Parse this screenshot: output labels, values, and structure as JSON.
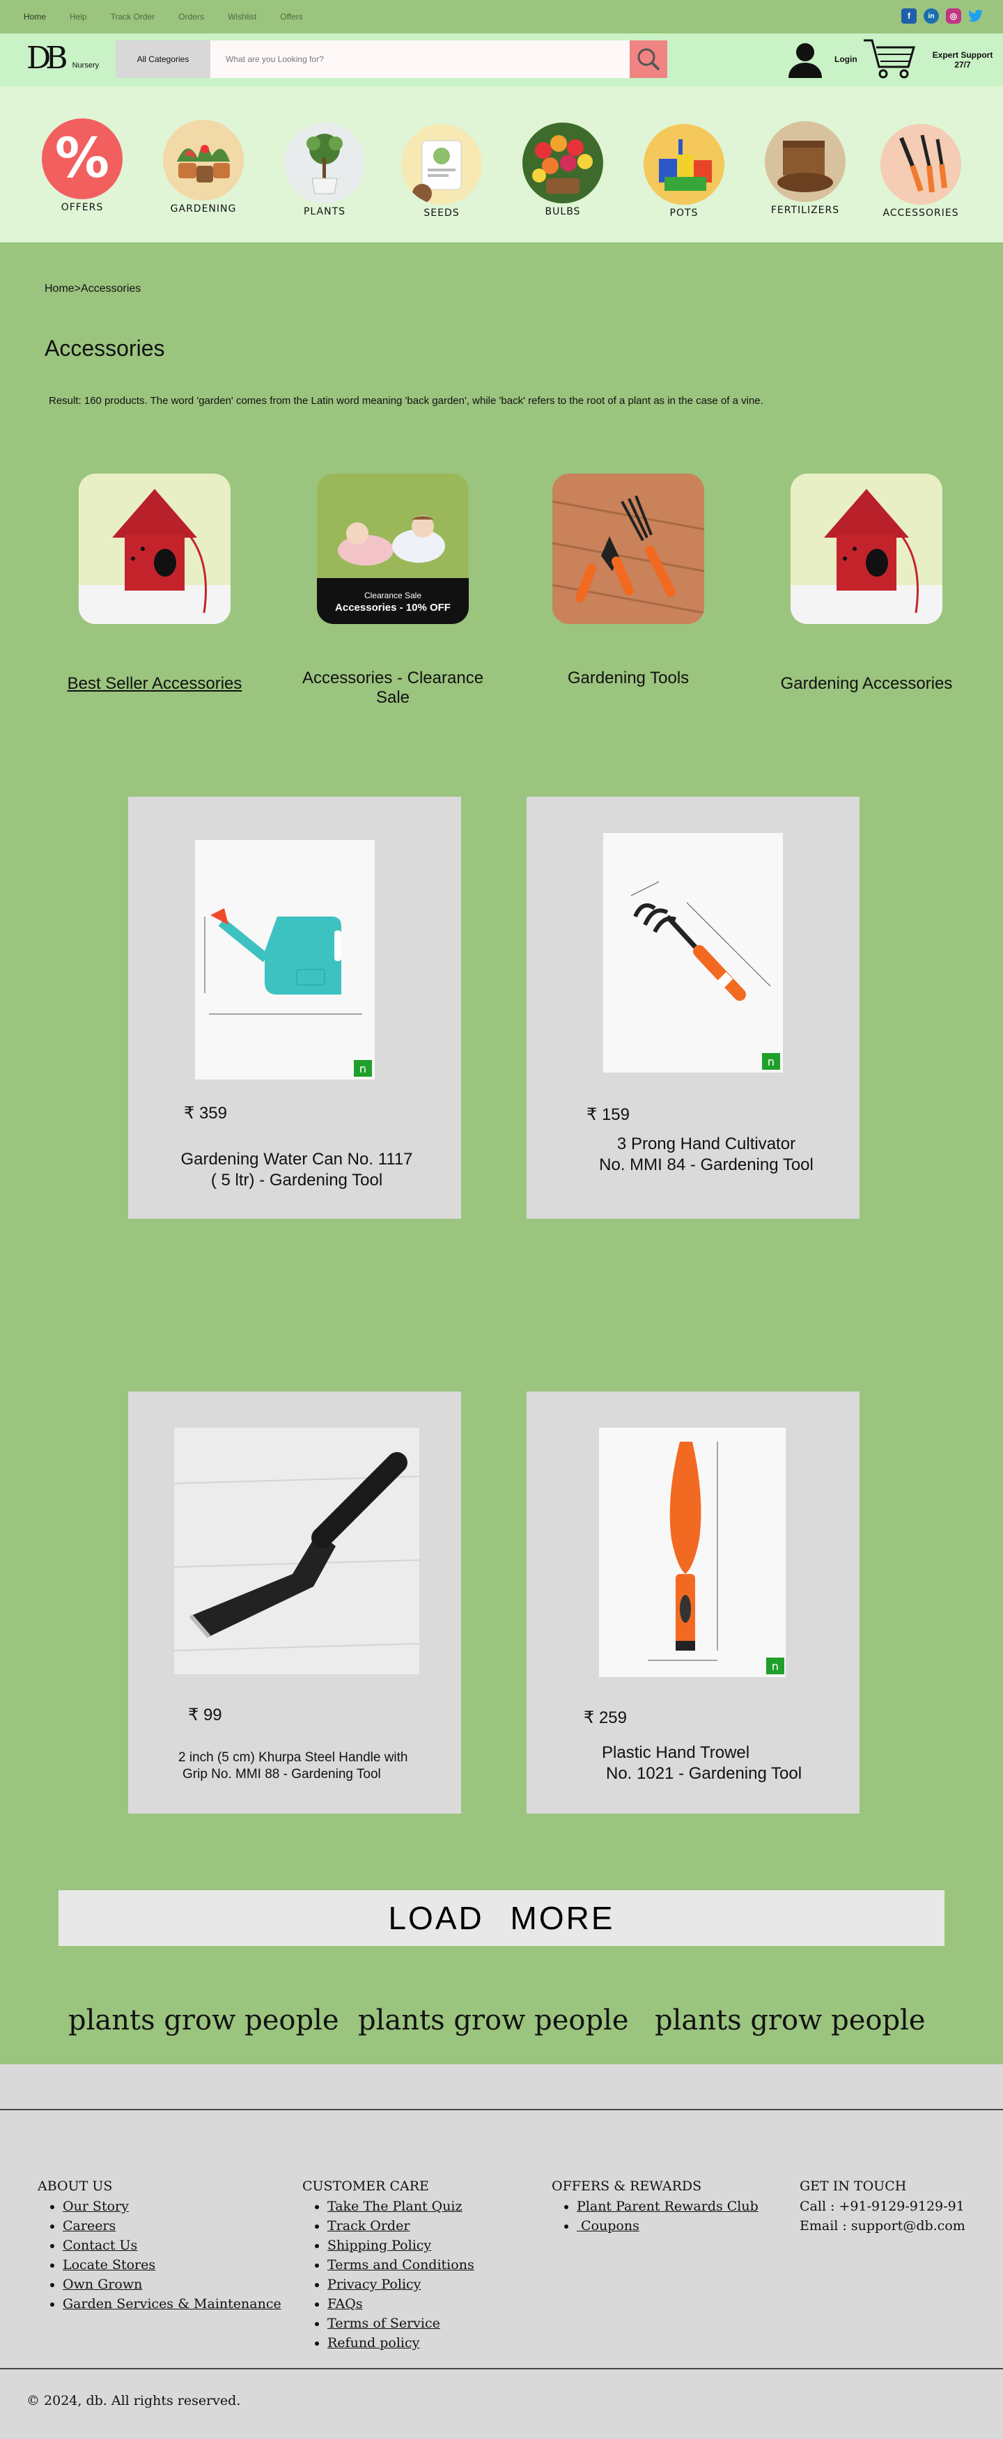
{
  "topnav": {
    "links": [
      "Home",
      "Help",
      "Track Order",
      "Orders",
      "Wishlist",
      "Offers"
    ]
  },
  "social": [
    {
      "icon": "facebook-icon",
      "glyph": "f",
      "color": "#1f5fa8"
    },
    {
      "icon": "linkedin-icon",
      "glyph": "in",
      "color": "#1a6fb0"
    },
    {
      "icon": "instagram-icon",
      "glyph": "◎",
      "color": "#c13584"
    },
    {
      "icon": "twitter-icon",
      "glyph": "🐦",
      "color": "#1da1f2"
    }
  ],
  "header": {
    "logo_mark": "DB",
    "logo_sub": "Nursery",
    "category_label": "All Categories",
    "search_placeholder": "What are you Looking for?",
    "login_label": "Login",
    "support_line1": "Expert Support",
    "support_line2": "27/7"
  },
  "categories": [
    {
      "label": "OFFERS",
      "icon": "percent-icon"
    },
    {
      "label": "GARDENING",
      "icon": "gardening-icon"
    },
    {
      "label": "PLANTS",
      "icon": "plant-icon"
    },
    {
      "label": "SEEDS",
      "icon": "seeds-icon"
    },
    {
      "label": "BULBS",
      "icon": "bulbs-icon"
    },
    {
      "label": "POTS",
      "icon": "pots-icon"
    },
    {
      "label": "FERTILIZERS",
      "icon": "fertilizer-icon"
    },
    {
      "label": "ACCESSORIES",
      "icon": "tools-icon"
    }
  ],
  "breadcrumb": "Home>Accessories",
  "page_title": "Accessories",
  "result_text": "Result: 160 products. The word 'garden' comes from the Latin word meaning 'back garden', while 'back' refers to the root of a plant as in the case of a vine.",
  "subcategories": [
    {
      "label": "Best Seller Accessories",
      "underlined": true
    },
    {
      "label": "Accessories - Clearance Sale",
      "overlay_line1": "Clearance Sale",
      "overlay_line2": "Accessories - 10% OFF"
    },
    {
      "label": "Gardening Tools"
    },
    {
      "label": "Gardening Accessories"
    }
  ],
  "products": [
    {
      "price": "₹ 359",
      "name_line1": "Gardening Water Can No. 1117",
      "name_line2": "( 5 ltr) - Gardening Tool"
    },
    {
      "price": "₹ 159",
      "name_line1": "3 Prong Hand Cultivator",
      "name_line2": "No. MMI 84 - Gardening Tool"
    },
    {
      "price": "₹ 99",
      "name_line1": "2 inch (5 cm) Khurpa Steel Handle with",
      "name_line2": "Grip No. MMI 88 - Gardening Tool"
    },
    {
      "price": "₹ 259",
      "name_line1": "Plastic Hand Trowel",
      "name_line2": "No. 1021 - Gardening Tool"
    }
  ],
  "load_more": "LOAD MORE",
  "tagline": "plants grow people",
  "footer": {
    "about": {
      "title": "ABOUT US",
      "items": [
        "Our Story",
        "Careers",
        "Contact Us",
        "Locate Stores",
        "Own Grown",
        "Garden Services & Maintenance"
      ]
    },
    "care": {
      "title": "CUSTOMER CARE",
      "items": [
        "Take The Plant Quiz",
        "Track Order",
        "Shipping Policy",
        "Terms and Conditions",
        "Privacy Policy",
        "FAQs",
        "Terms of Service",
        "Refund policy"
      ]
    },
    "offers": {
      "title": "OFFERS & REWARDS",
      "items": [
        "Plant Parent Rewards Club",
        " Coupons"
      ]
    },
    "contact": {
      "title": "GET IN TOUCH",
      "call": "Call : +91-9129-9129-91",
      "email": "Email : support@db.com"
    },
    "copyright": "© 2024, db. All rights reserved."
  },
  "colors": {
    "page_bg": "#9bc47f",
    "header_bg": "#c9f2c7",
    "category_bg": "#dff5d6",
    "search_button": "#f08482",
    "card_bg": "#dadada",
    "footer_bg": "#d9d9d9"
  }
}
